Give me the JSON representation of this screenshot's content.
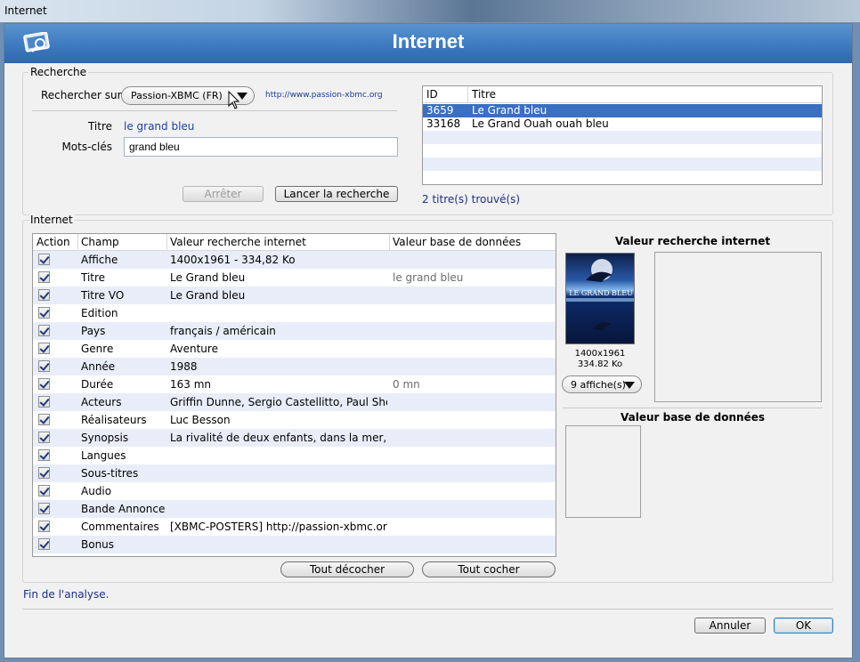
{
  "os_window_title": "Internet",
  "header": {
    "title": "Internet"
  },
  "recherche": {
    "group_label": "Recherche",
    "search_on_label": "Rechercher sur",
    "source_value": "Passion-XBMC (FR)",
    "source_url": "http://www.passion-xbmc.org",
    "titre_label": "Titre",
    "titre_value": "le grand bleu",
    "keywords_label": "Mots-clés",
    "keywords_value": "grand bleu",
    "stop_button": "Arrêter",
    "search_button": "Lancer la recherche",
    "results_columns": [
      "ID",
      "Titre"
    ],
    "results": [
      {
        "id": "3659",
        "title": "Le Grand bleu",
        "selected": true
      },
      {
        "id": "33168",
        "title": "Le Grand Ouah ouah bleu",
        "selected": false
      }
    ],
    "found_text": "2 titre(s) trouvé(s)"
  },
  "internet": {
    "group_label": "Internet",
    "columns": [
      "Action",
      "Champ",
      "Valeur recherche internet",
      "Valeur base de données"
    ],
    "rows": [
      {
        "checked": true,
        "field": "Affiche",
        "web": "1400x1961 - 334,82 Ko",
        "db": ""
      },
      {
        "checked": true,
        "field": "Titre",
        "web": "Le Grand bleu",
        "db": "le grand bleu"
      },
      {
        "checked": true,
        "field": "Titre VO",
        "web": "Le Grand bleu",
        "db": ""
      },
      {
        "checked": true,
        "field": "Edition",
        "web": "",
        "db": ""
      },
      {
        "checked": true,
        "field": "Pays",
        "web": "français / américain",
        "db": ""
      },
      {
        "checked": true,
        "field": "Genre",
        "web": "Aventure",
        "db": ""
      },
      {
        "checked": true,
        "field": "Année",
        "web": "1988",
        "db": ""
      },
      {
        "checked": true,
        "field": "Durée",
        "web": "163 mn",
        "db": "0 mn"
      },
      {
        "checked": true,
        "field": "Acteurs",
        "web": "Griffin Dunne, Sergio Castellitto, Paul Shenar...",
        "db": ""
      },
      {
        "checked": true,
        "field": "Réalisateurs",
        "web": "Luc Besson",
        "db": ""
      },
      {
        "checked": true,
        "field": "Synopsis",
        "web": "La rivalité de deux enfants, dans la mer, en G...",
        "db": ""
      },
      {
        "checked": true,
        "field": "Langues",
        "web": "",
        "db": ""
      },
      {
        "checked": true,
        "field": "Sous-titres",
        "web": "",
        "db": ""
      },
      {
        "checked": true,
        "field": "Audio",
        "web": "",
        "db": ""
      },
      {
        "checked": true,
        "field": "Bande Annonce",
        "web": "",
        "db": ""
      },
      {
        "checked": true,
        "field": "Commentaires",
        "web": " [XBMC-POSTERS] http://passion-xbmc.org/...",
        "db": ""
      },
      {
        "checked": true,
        "field": "Bonus",
        "web": "",
        "db": ""
      }
    ],
    "uncheck_all": "Tout décocher",
    "check_all": "Tout cocher",
    "web_value_title": "Valeur recherche internet",
    "poster_text": "LE GRAND BLEU",
    "poster_dims": "1400x1961",
    "poster_size": "334.82 Ko",
    "posters_combo": "9 affiche(s)",
    "db_value_title": "Valeur base de données"
  },
  "status": "Fin de l'analyse.",
  "footer": {
    "cancel": "Annuler",
    "ok": "OK"
  },
  "colors": {
    "header_blue": "#3f7cc1",
    "selection": "#3a6fc1",
    "alt_row": "#e8edf9",
    "link_blue": "#1b3fa6"
  }
}
